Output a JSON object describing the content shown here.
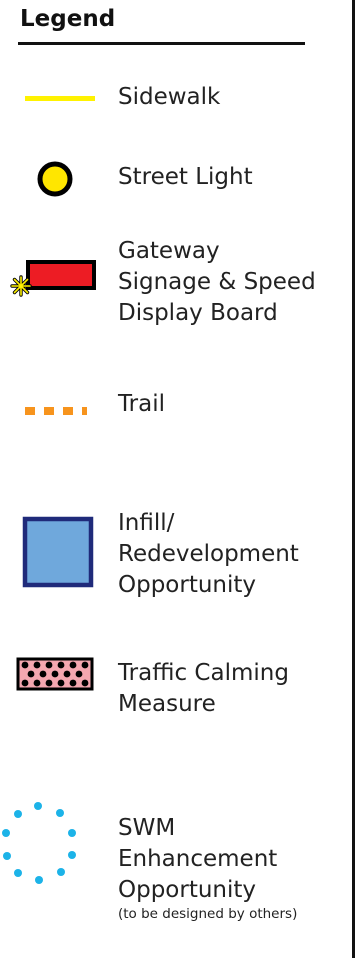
{
  "legend": {
    "title": "Legend",
    "items": [
      {
        "key": "sidewalk",
        "lines": [
          "Sidewalk"
        ],
        "color": "#fff200"
      },
      {
        "key": "street_light",
        "lines": [
          "Street Light"
        ],
        "color": "#ffe600"
      },
      {
        "key": "gateway",
        "lines": [
          "Gateway",
          "Signage & Speed",
          "Display Board"
        ],
        "color": "#ed1c24",
        "marker_color": "#fff200"
      },
      {
        "key": "trail",
        "lines": [
          "Trail"
        ],
        "color": "#f7941d"
      },
      {
        "key": "infill",
        "lines": [
          "Infill/",
          "Redevelopment",
          "Opportunity"
        ],
        "color": "#6fa8dc",
        "border_color": "#1f2a7a"
      },
      {
        "key": "traffic_calming",
        "lines": [
          "Traffic Calming",
          "Measure"
        ],
        "color": "#f4a7b0"
      },
      {
        "key": "swm",
        "lines": [
          "SWM",
          "Enhancement",
          "Opportunity"
        ],
        "note": "(to be designed by others)",
        "color": "#1cb3e8"
      }
    ]
  }
}
